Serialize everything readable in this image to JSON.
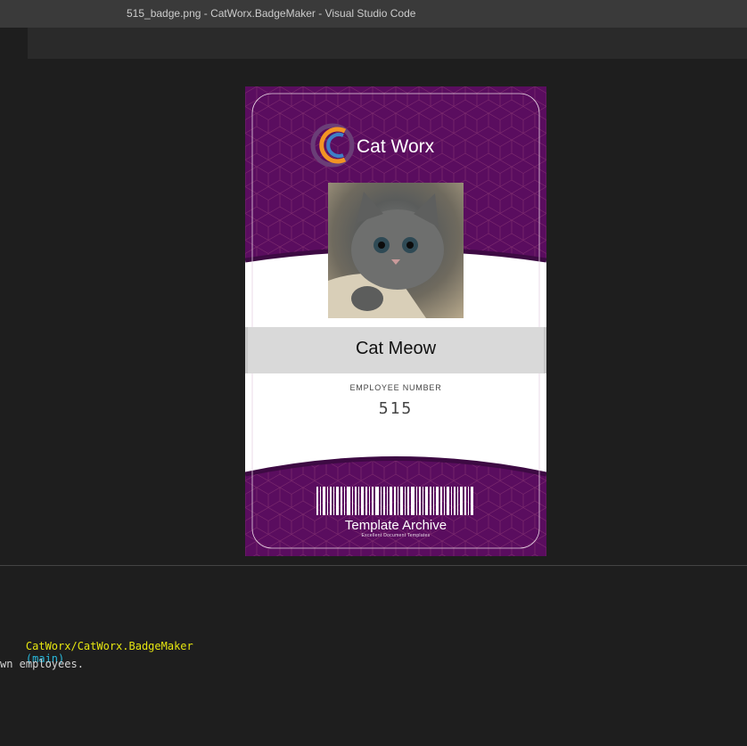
{
  "window": {
    "title": "515_badge.png - CatWorx.BadgeMaker - Visual Studio Code"
  },
  "badge": {
    "company": "Cat Worx",
    "employee_name": "Cat Meow",
    "employee_number_label": "EMPLOYEE NUMBER",
    "employee_number": "515",
    "brand": "Template Archive",
    "brand_tagline": "Excellent Document Templates",
    "photo_icon": "kitten-photo",
    "logo_icon": "cat-worx-logo",
    "colors": {
      "purple": "#5a0d5f",
      "purple_dark": "#3d0a43",
      "logo_orange": "#f29423",
      "logo_blue": "#3d7fc6"
    }
  },
  "terminal": {
    "path": "CatWorx/CatWorx.BadgeMaker",
    "branch": "(main)",
    "output": "wn employees."
  }
}
